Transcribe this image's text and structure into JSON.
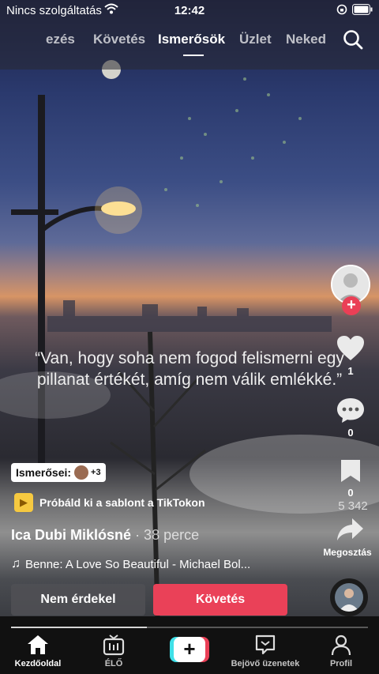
{
  "status_bar": {
    "carrier": "Nincs szolgáltatás",
    "time": "12:42"
  },
  "top_tabs": [
    {
      "label": "ezés",
      "active": false
    },
    {
      "label": "Követés",
      "active": false
    },
    {
      "label": "Ismerősök",
      "active": true
    },
    {
      "label": "Üzlet",
      "active": false
    },
    {
      "label": "Neked",
      "active": false
    }
  ],
  "video": {
    "quote": "“Van, hogy soha nem fogod felismerni egy pillanat értékét, amíg nem válik emlékké.”"
  },
  "actions": {
    "likes": "1",
    "comments": "0",
    "bookmarks": "0",
    "shares": "5 342",
    "share_label": "Megosztás"
  },
  "info": {
    "friends_label": "Ismerősei:",
    "friends_extra": "+3",
    "template_text": "Próbáld ki a sablont a TikTokon",
    "author": "Ica Dubi Miklósné",
    "time_ago": "· 38 perce",
    "music": "Benne: A Love So Beautiful - Michael Bol..."
  },
  "buttons": {
    "not_interested": "Nem érdekel",
    "follow": "Követés"
  },
  "progress": 0.38,
  "bottom_nav": [
    {
      "label": "Kezdőoldal",
      "icon": "home-icon",
      "active": true
    },
    {
      "label": "ÉLŐ",
      "icon": "live-tv-icon",
      "active": false
    },
    {
      "label": "Bejövő üzenetek",
      "icon": "inbox-icon",
      "active": false
    },
    {
      "label": "Profil",
      "icon": "profile-icon",
      "active": false
    }
  ],
  "colors": {
    "accent": "#ea4158",
    "create_cyan": "#3fe0e8"
  }
}
